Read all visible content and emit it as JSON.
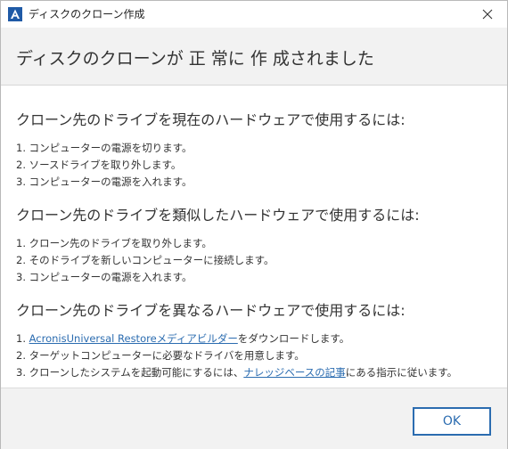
{
  "window": {
    "title": "ディスクのクローン作成",
    "app_icon_letter": "A"
  },
  "heading": "ディスクのクローンが 正 常に 作 成されました",
  "sections": [
    {
      "title": "クローン先のドライブを現在のハードウェアで使用するには:",
      "steps": [
        "1. コンピューターの電源を切ります。",
        "2. ソースドライブを取り外します。",
        "3. コンピューターの電源を入れます。"
      ]
    },
    {
      "title": "クローン先のドライブを類似したハードウェアで使用するには:",
      "steps": [
        "1. クローン先のドライブを取り外します。",
        "2. そのドライブを新しいコンピューターに接続します。",
        "3. コンピューターの電源を入れます。"
      ]
    },
    {
      "title": "クローン先のドライブを異なるハードウェアで使用するには:",
      "steps": [
        {
          "prefix": "1. ",
          "link": "AcronisUniversal Restoreメディアビルダー",
          "suffix": "をダウンロードします。"
        },
        {
          "text": "2. ターゲットコンピューターに必要なドライバを用意します。"
        },
        {
          "prefix": "3. クローンしたシステムを起動可能にするには、",
          "link": "ナレッジベースの記事",
          "suffix": "にある指示に従います。"
        }
      ]
    }
  ],
  "footer": {
    "ok_label": "OK"
  },
  "colors": {
    "accent": "#2b6cb0",
    "heading_bg": "#f2f2f2",
    "app_icon": "#1f5aa6"
  },
  "icons": {
    "app": "acronis-logo-icon",
    "close": "close-icon"
  }
}
